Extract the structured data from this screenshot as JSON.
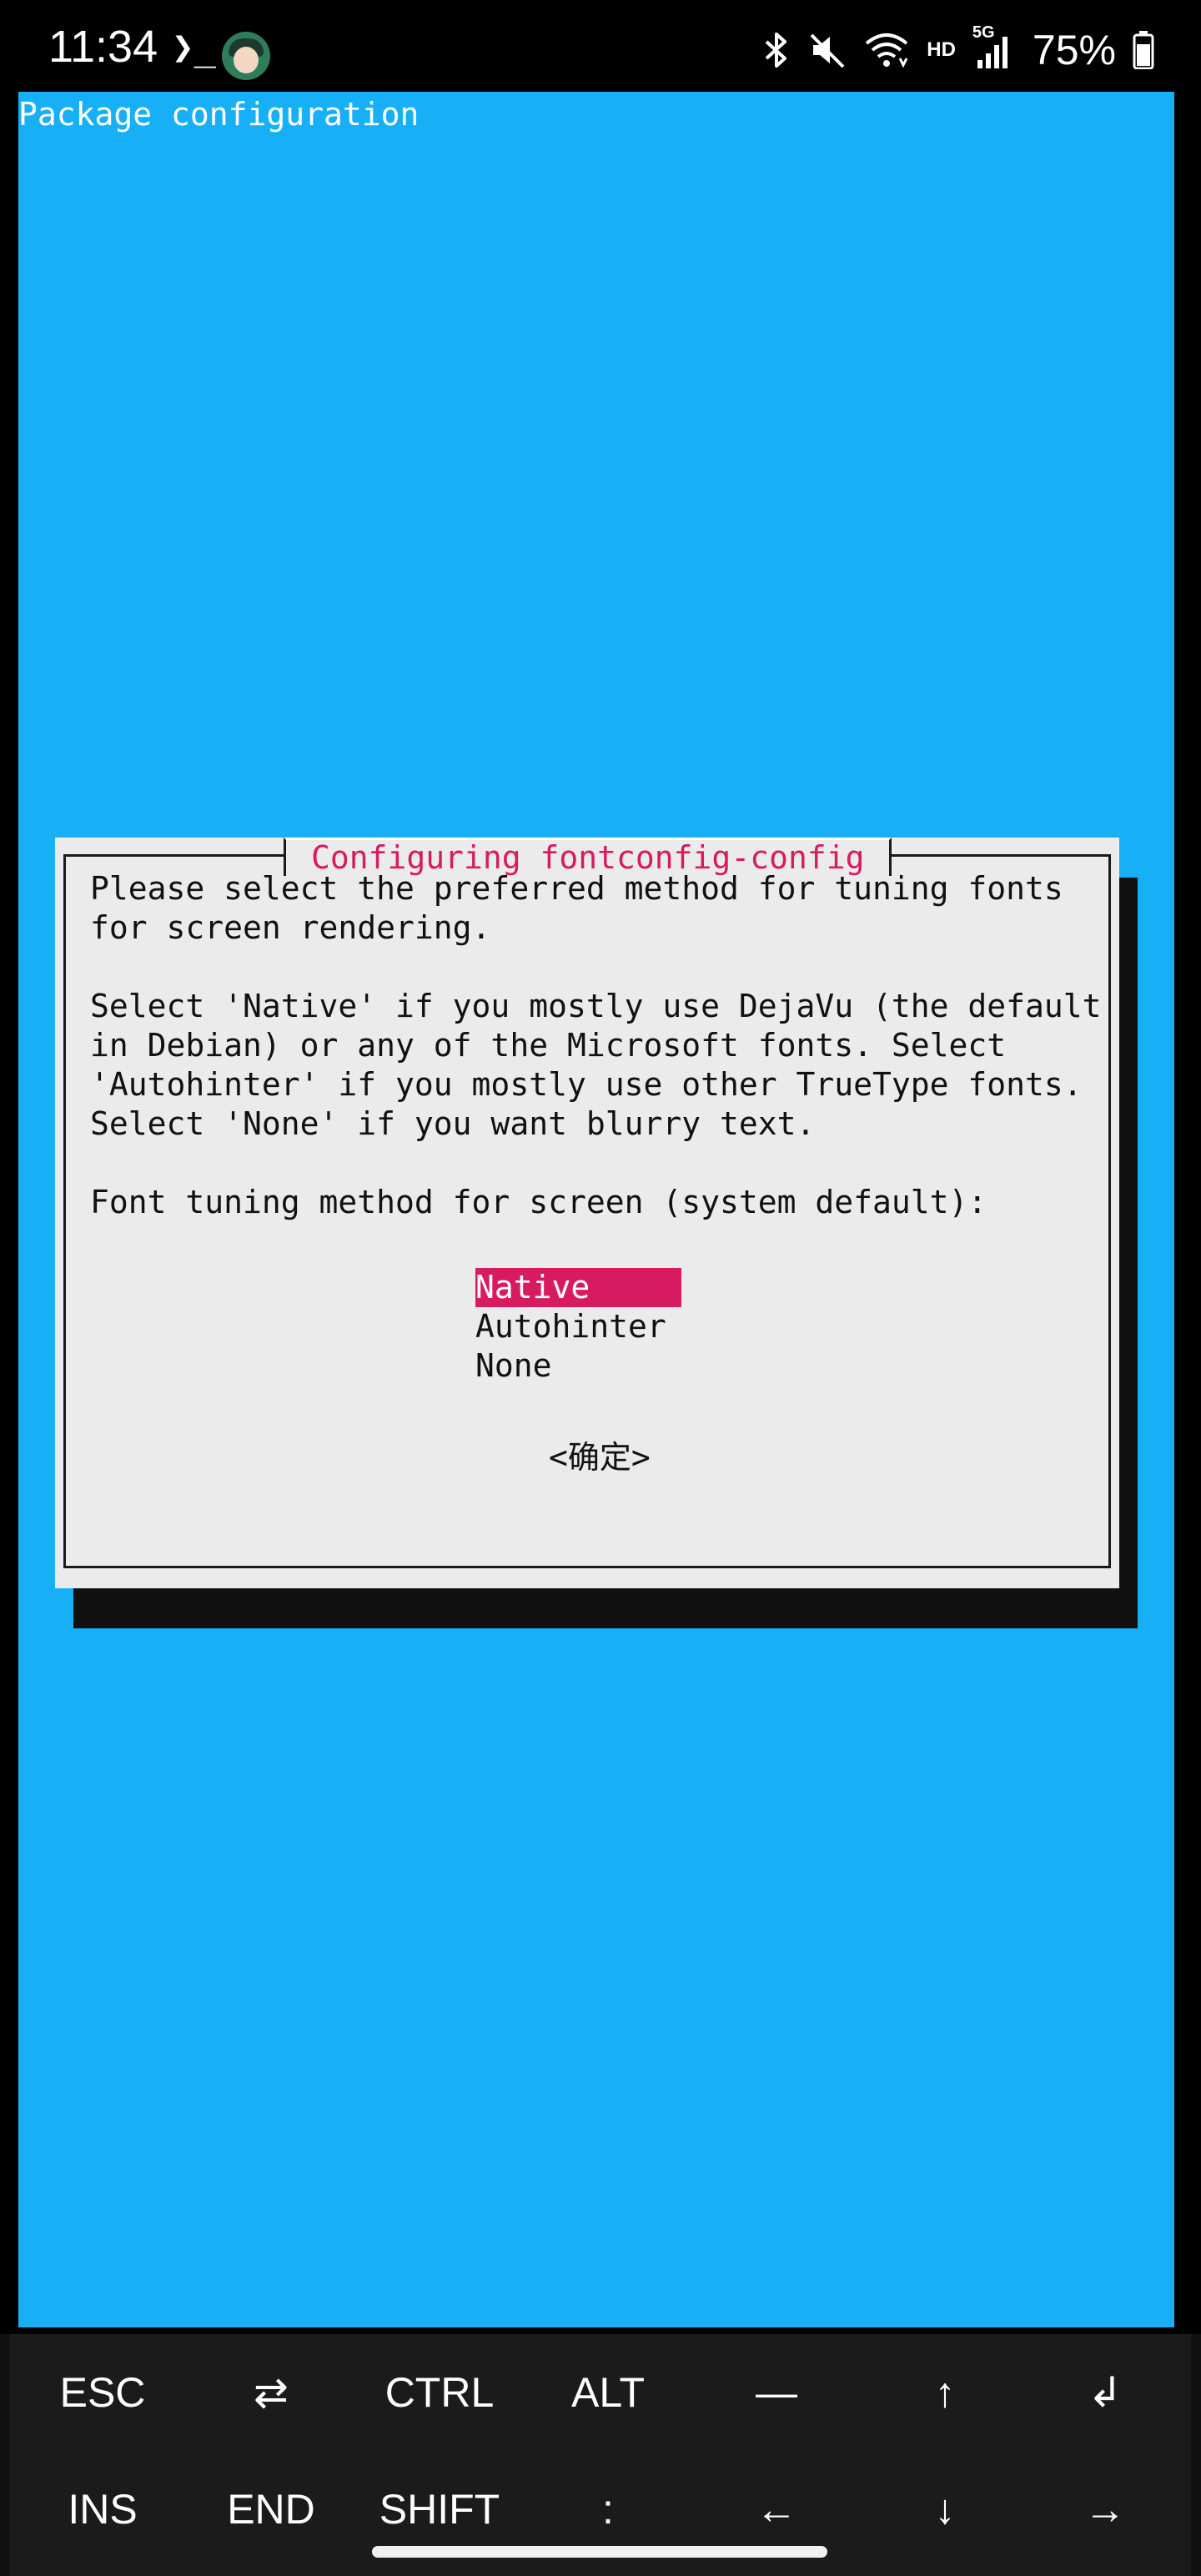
{
  "status_bar": {
    "time": "11:34",
    "terminal_glyph": "❯_",
    "hd": "HD",
    "network": "5G",
    "battery": "75%"
  },
  "terminal": {
    "header": "Package configuration",
    "background_color": "#17b0f7",
    "dialog": {
      "title": "Configuring fontconfig-config",
      "lines": [
        "Please select the preferred method for tuning fonts",
        "for screen rendering.",
        "Select 'Native' if you mostly use DejaVu (the default",
        "in Debian) or any of the Microsoft fonts. Select",
        "'Autohinter' if you mostly use other TrueType fonts.",
        "Select 'None' if you want blurry text.",
        "Font tuning method for screen (system default):"
      ],
      "options": [
        "Native",
        "Autohinter",
        "None"
      ],
      "selected_option": "Native",
      "ok_button": "<确定>",
      "accent_color": "#d81b60"
    }
  },
  "extra_keys": {
    "row1": [
      "ESC",
      "⇄",
      "CTRL",
      "ALT",
      "—",
      "↑",
      "↲"
    ],
    "row2": [
      "INS",
      "END",
      "SHIFT",
      ":",
      "←",
      "↓",
      "→"
    ]
  }
}
